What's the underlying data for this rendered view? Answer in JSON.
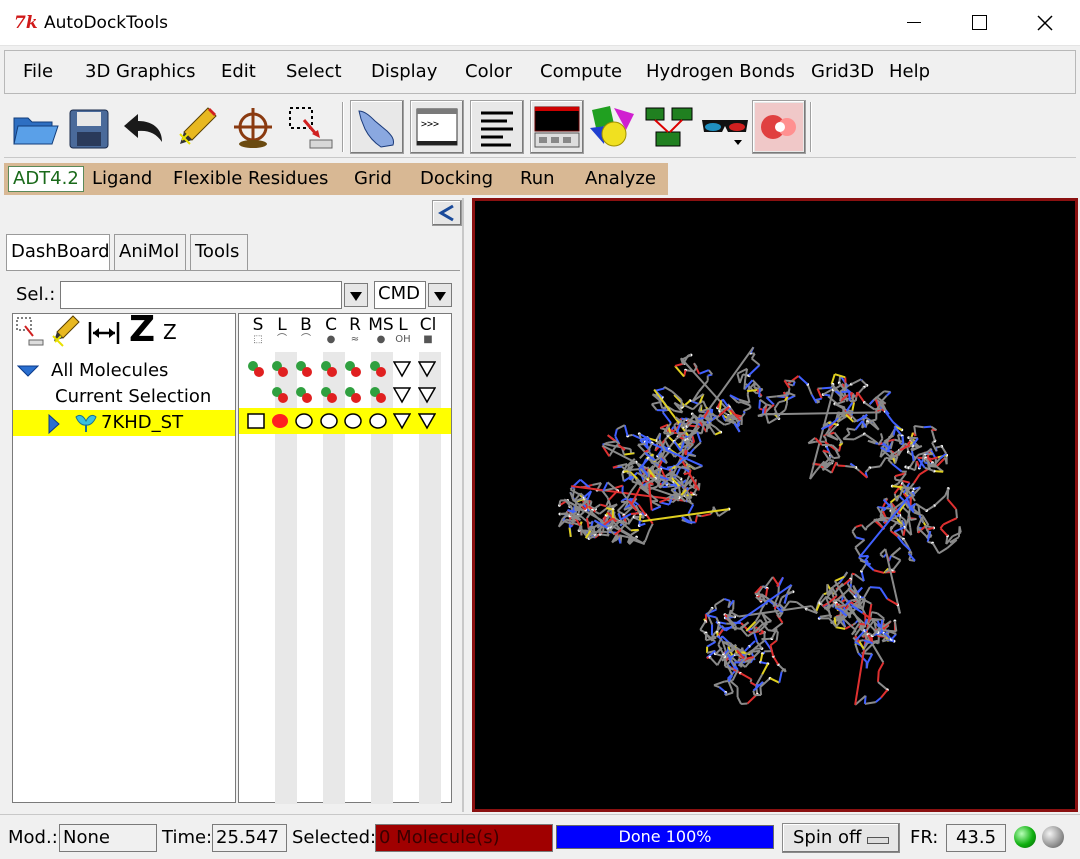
{
  "window": {
    "title": "AutoDockTools"
  },
  "menu": [
    "File",
    "3D Graphics",
    "Edit",
    "Select",
    "Display",
    "Color",
    "Compute",
    "Hydrogen Bonds",
    "Grid3D",
    "Help"
  ],
  "toolbar_icons": [
    "open-folder-icon",
    "save-floppy-icon",
    "undo-arrow-icon",
    "pencil-pick-icon",
    "crosshair-center-icon",
    "selection-tool-icon",
    "pointing-hand-icon",
    "python-shell-icon",
    "text-lines-icon",
    "log-window-icon",
    "geometry-shapes-icon",
    "network-editor-icon",
    "stereo-glasses-icon",
    "render-icon"
  ],
  "command_tabs": [
    "ADT4.2",
    "Ligand",
    "Flexible Residues",
    "Grid",
    "Docking",
    "Run",
    "Analyze"
  ],
  "notebook_tabs": [
    "DashBoard",
    "AniMol",
    "Tools"
  ],
  "dashboard": {
    "sel_label": "Sel.:",
    "sel_value": "",
    "cmd_value": "CMD",
    "zoom_big": "Z",
    "zoom_small": "Z",
    "tree": {
      "all_molecules": "All Molecules",
      "current_selection": "Current Selection",
      "molecule": "7KHD_ST"
    },
    "columns": [
      {
        "head": "S",
        "sub": "⬚"
      },
      {
        "head": "L",
        "sub": "⌒"
      },
      {
        "head": "B",
        "sub": "⌒"
      },
      {
        "head": "C",
        "sub": "●"
      },
      {
        "head": "R",
        "sub": "≈"
      },
      {
        "head": "MS",
        "sub": "●"
      },
      {
        "head": "L",
        "sub": "OH"
      },
      {
        "head": "Cl",
        "sub": "■"
      }
    ]
  },
  "status": {
    "mod_label": "Mod.:",
    "mod_value": "None",
    "time_label": "Time:",
    "time_value": "25.547",
    "selected_label": "Selected:",
    "selected_value": "0 Molecule(s)",
    "progress_text": "Done 100%",
    "progress": 1.0,
    "spin_label": "Spin off",
    "fr_label": "FR:",
    "fr_value": "43.5"
  },
  "colors": {
    "command_bar": "#d8b894",
    "highlight": "#ffff00",
    "viewer_bg": "#000000",
    "viewer_border": "#8a1010",
    "selected_bg": "#a00000",
    "progress": "#0000ff"
  }
}
